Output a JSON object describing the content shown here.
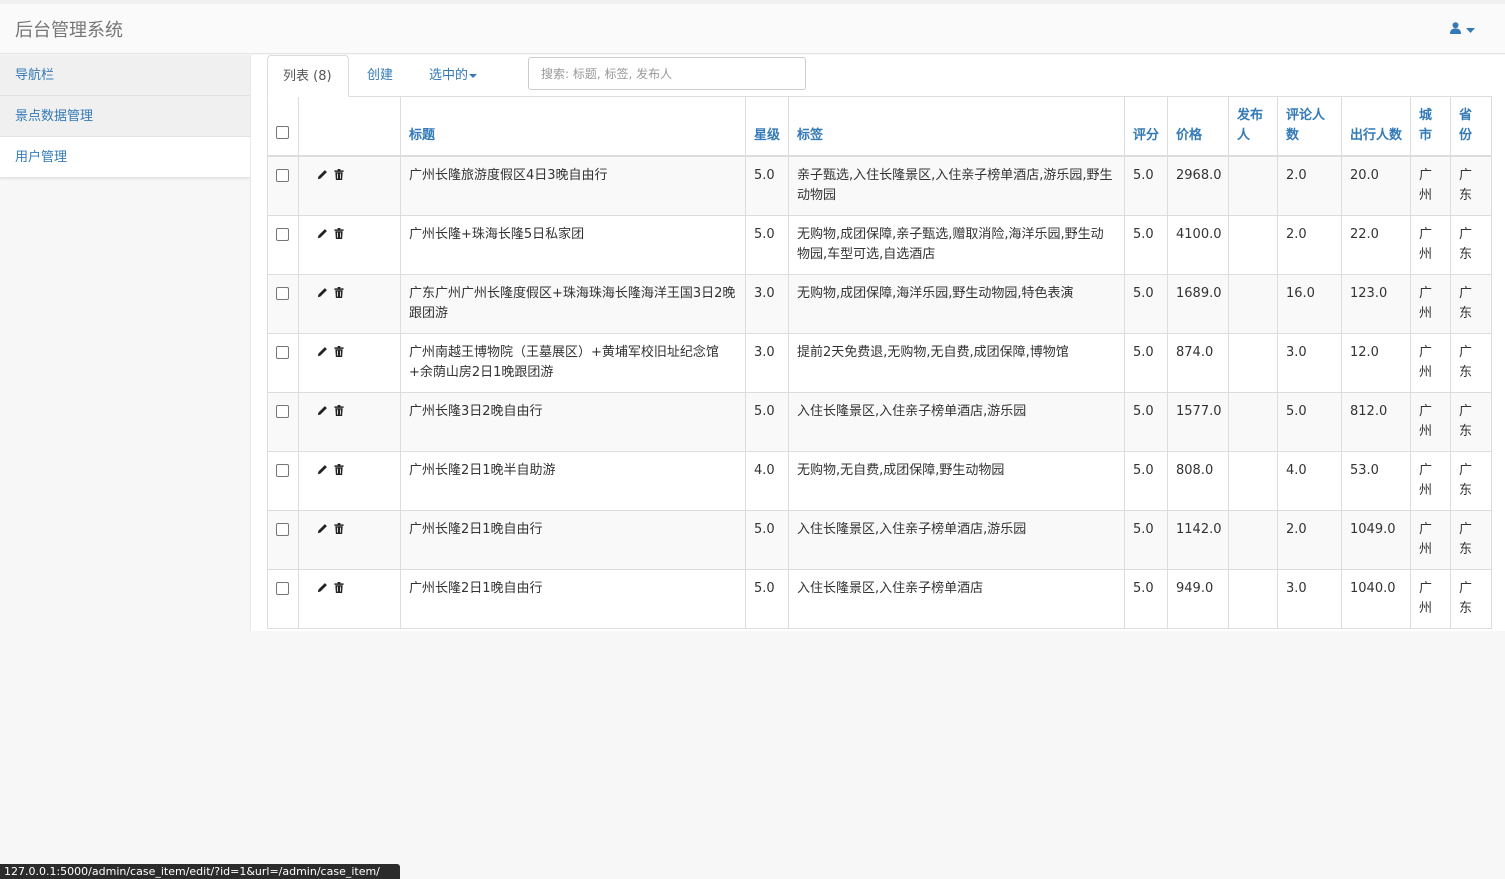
{
  "app": {
    "title": "后台管理系统"
  },
  "header": {
    "user_icon": "user-icon",
    "caret_icon": "chevron-down-icon"
  },
  "sidebar": {
    "items": [
      {
        "label": "导航栏"
      },
      {
        "label": "景点数据管理"
      },
      {
        "label": "用户管理"
      }
    ]
  },
  "tabs": {
    "list": "列表 (8)",
    "create": "创建",
    "selected": "选中的"
  },
  "search": {
    "placeholder": "搜索: 标题, 标签, 发布人",
    "value": ""
  },
  "table": {
    "headers": {
      "title": "标题",
      "stars": "星级",
      "tags": "标签",
      "score": "评分",
      "price": "价格",
      "publisher": "发布人",
      "reviewers": "评论人数",
      "travelers": "出行人数",
      "city": "城市",
      "province": "省份"
    },
    "rows": [
      {
        "title": "广州长隆旅游度假区4日3晚自由行",
        "stars": "5.0",
        "tags": "亲子甄选,入住长隆景区,入住亲子榜单酒店,游乐园,野生动物园",
        "score": "5.0",
        "price": "2968.0",
        "publisher": "",
        "reviewers": "2.0",
        "travelers": "20.0",
        "city": "广州",
        "province": "广东"
      },
      {
        "title": "广州长隆+珠海长隆5日私家团",
        "stars": "5.0",
        "tags": "无购物,成团保障,亲子甄选,赠取消险,海洋乐园,野生动物园,车型可选,自选酒店",
        "score": "5.0",
        "price": "4100.0",
        "publisher": "",
        "reviewers": "2.0",
        "travelers": "22.0",
        "city": "广州",
        "province": "广东"
      },
      {
        "title": "广东广州广州长隆度假区+珠海珠海长隆海洋王国3日2晚跟团游",
        "stars": "3.0",
        "tags": "无购物,成团保障,海洋乐园,野生动物园,特色表演",
        "score": "5.0",
        "price": "1689.0",
        "publisher": "",
        "reviewers": "16.0",
        "travelers": "123.0",
        "city": "广州",
        "province": "广东"
      },
      {
        "title": "广州南越王博物院（王墓展区）+黄埔军校旧址纪念馆+余荫山房2日1晚跟团游",
        "stars": "3.0",
        "tags": "提前2天免费退,无购物,无自费,成团保障,博物馆",
        "score": "5.0",
        "price": "874.0",
        "publisher": "",
        "reviewers": "3.0",
        "travelers": "12.0",
        "city": "广州",
        "province": "广东"
      },
      {
        "title": "广州长隆3日2晚自由行",
        "stars": "5.0",
        "tags": "入住长隆景区,入住亲子榜单酒店,游乐园",
        "score": "5.0",
        "price": "1577.0",
        "publisher": "",
        "reviewers": "5.0",
        "travelers": "812.0",
        "city": "广州",
        "province": "广东"
      },
      {
        "title": "广州长隆2日1晚半自助游",
        "stars": "4.0",
        "tags": "无购物,无自费,成团保障,野生动物园",
        "score": "5.0",
        "price": "808.0",
        "publisher": "",
        "reviewers": "4.0",
        "travelers": "53.0",
        "city": "广州",
        "province": "广东"
      },
      {
        "title": "广州长隆2日1晚自由行",
        "stars": "5.0",
        "tags": "入住长隆景区,入住亲子榜单酒店,游乐园",
        "score": "5.0",
        "price": "1142.0",
        "publisher": "",
        "reviewers": "2.0",
        "travelers": "1049.0",
        "city": "广州",
        "province": "广东"
      },
      {
        "title": "广州长隆2日1晚自由行",
        "stars": "5.0",
        "tags": "入住长隆景区,入住亲子榜单酒店",
        "score": "5.0",
        "price": "949.0",
        "publisher": "",
        "reviewers": "3.0",
        "travelers": "1040.0",
        "city": "广州",
        "province": "广东"
      }
    ]
  },
  "status_bar": {
    "url": "127.0.0.1:5000/admin/case_item/edit/?id=1&url=/admin/case_item/"
  },
  "colors": {
    "link": "#337ab7",
    "text": "#333333",
    "border": "#dddddd",
    "stripe": "#f9f9f9"
  }
}
